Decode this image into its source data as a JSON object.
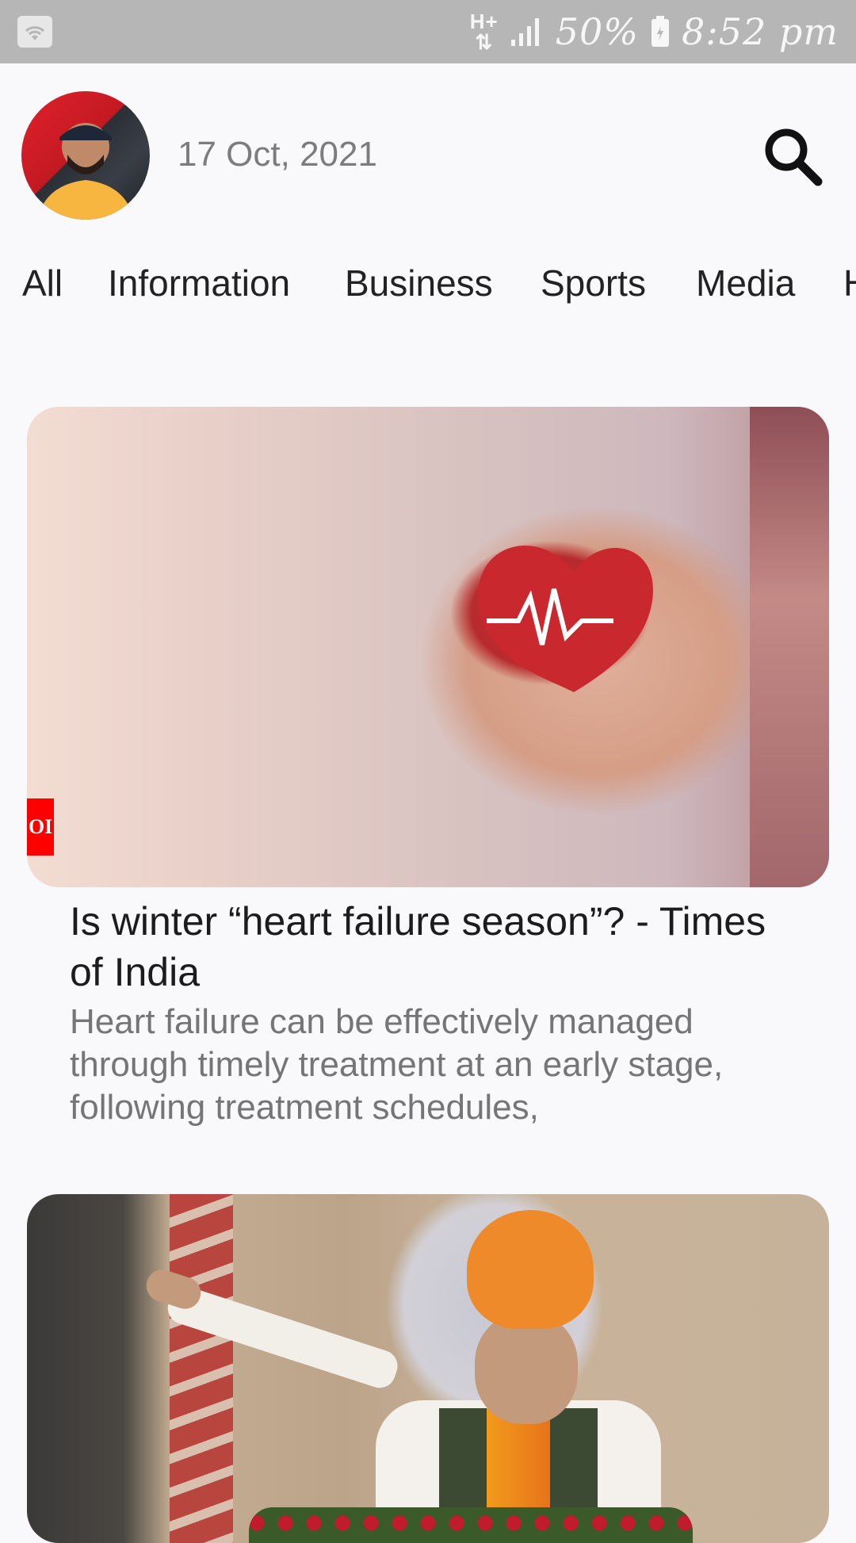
{
  "status_bar": {
    "network": "H+",
    "battery_percent": "50%",
    "time": "8:52 pm",
    "icons": [
      "wifi-icon",
      "data-arrows-icon",
      "signal-icon",
      "battery-icon"
    ]
  },
  "header": {
    "date": "17 Oct, 2021",
    "search_icon": "search-icon"
  },
  "tabs": [
    {
      "label": "All"
    },
    {
      "label": "Information"
    },
    {
      "label": "Business"
    },
    {
      "label": "Sports"
    },
    {
      "label": "Media"
    },
    {
      "label": "H"
    }
  ],
  "articles": [
    {
      "badge": "OI",
      "title": "Is winter “heart failure season”? - Times of India",
      "description": "Heart failure can be effectively managed through timely treatment at an early stage, following treatment schedules,"
    },
    {
      "title": "",
      "description": ""
    }
  ],
  "colors": {
    "background": "#f9f9fb",
    "status_bar": "#b6b6b6",
    "date_text": "#7c7c7c",
    "title_text": "#1c1c1c",
    "description_text": "#757575",
    "badge_red": "#ff0000"
  }
}
